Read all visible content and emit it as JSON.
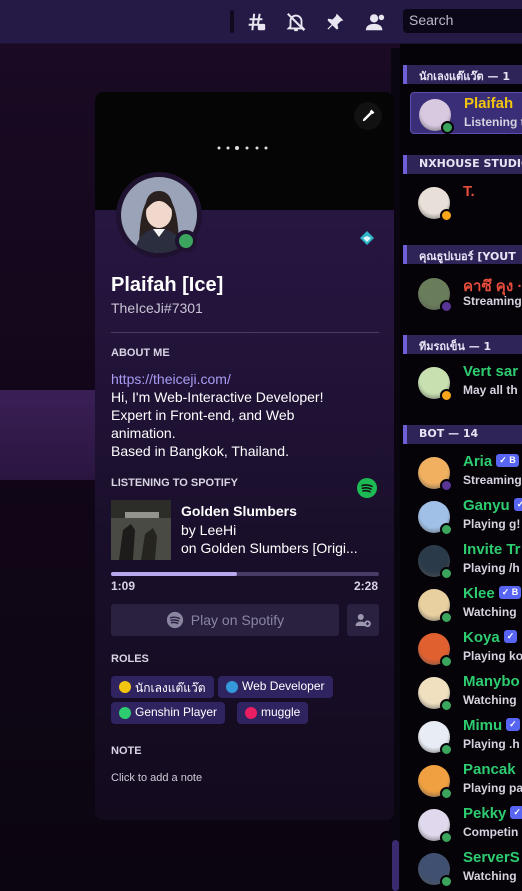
{
  "search": {
    "label": "Search"
  },
  "profile": {
    "display_name": "Plaifah [Ice]",
    "tag": "TheIceJi#7301",
    "about_heading": "ABOUT ME",
    "about_link": "https://theiceji.com/",
    "about_lines": [
      "Hi, I'm Web-Interactive Developer!",
      "Expert in Front-end, and Web",
      "animation.",
      "Based in Bangkok, Thailand."
    ],
    "listening_heading": "LISTENING TO SPOTIFY",
    "song_title": "Golden Slumbers",
    "song_artist": "by LeeHi",
    "song_album": "on Golden Slumbers [Origi...",
    "progress_fraction": 0.47,
    "time_elapsed": "1:09",
    "time_total": "2:28",
    "play_button": "Play on Spotify",
    "roles_heading": "ROLES",
    "roles": [
      {
        "label": "นักเลงแต๊แว๊ต",
        "color": "#f1c40f"
      },
      {
        "label": "Web Developer",
        "color": "#3498db"
      },
      {
        "label": "Genshin Player",
        "color": "#2ecc71"
      },
      {
        "label": "muggle",
        "color": "#e91e63"
      }
    ],
    "note_heading": "NOTE",
    "note_placeholder": "Click to add a note"
  },
  "member_list": {
    "categories": [
      "นักเลงแต๊แว๊ต — 1",
      "NXHOUSE STUDIO",
      "คุณธูปเบอร์ [YOUT",
      "ทีมรถเข็น — 1",
      "BOT — 14"
    ],
    "members": [
      {
        "name": "Plaifah",
        "sub": "Listening t",
        "color": "#f1c40f",
        "status": "online"
      },
      {
        "name": "T.",
        "sub": "",
        "color": "#e74c3c",
        "status": "idle"
      },
      {
        "name": "คาซึ คุง ·",
        "sub": "Streaming",
        "color": "#e74c3c",
        "status": "streaming"
      },
      {
        "name": "Vert sar",
        "sub": "May all th",
        "color": "#2ecc71",
        "status": "idle"
      },
      {
        "name": "Aria",
        "sub": "Streaming",
        "color": "#2ecc71",
        "status": "streaming",
        "badge": "✓ B"
      },
      {
        "name": "Ganyu",
        "sub": "Playing g!",
        "color": "#2ecc71",
        "status": "online",
        "badge": ""
      },
      {
        "name": "Invite Tr",
        "sub": "Playing /h",
        "color": "#2ecc71",
        "status": "online"
      },
      {
        "name": "Klee",
        "sub": "Watching",
        "color": "#2ecc71",
        "status": "online",
        "badge": "✓ B"
      },
      {
        "name": "Koya",
        "sub": "Playing ko",
        "color": "#2ecc71",
        "status": "online",
        "badge": "✓"
      },
      {
        "name": "Manybo",
        "sub": "Watching",
        "color": "#2ecc71",
        "status": "online"
      },
      {
        "name": "Mimu",
        "sub": "Playing .h",
        "color": "#2ecc71",
        "status": "online",
        "badge": "✓"
      },
      {
        "name": "Pancak",
        "sub": "Playing pa",
        "color": "#2ecc71",
        "status": "online"
      },
      {
        "name": "Pekky",
        "sub": "Competin",
        "color": "#2ecc71",
        "status": "online",
        "badge": "✓"
      },
      {
        "name": "ServerS",
        "sub": "Watching",
        "color": "#2ecc71",
        "status": "online"
      }
    ]
  }
}
